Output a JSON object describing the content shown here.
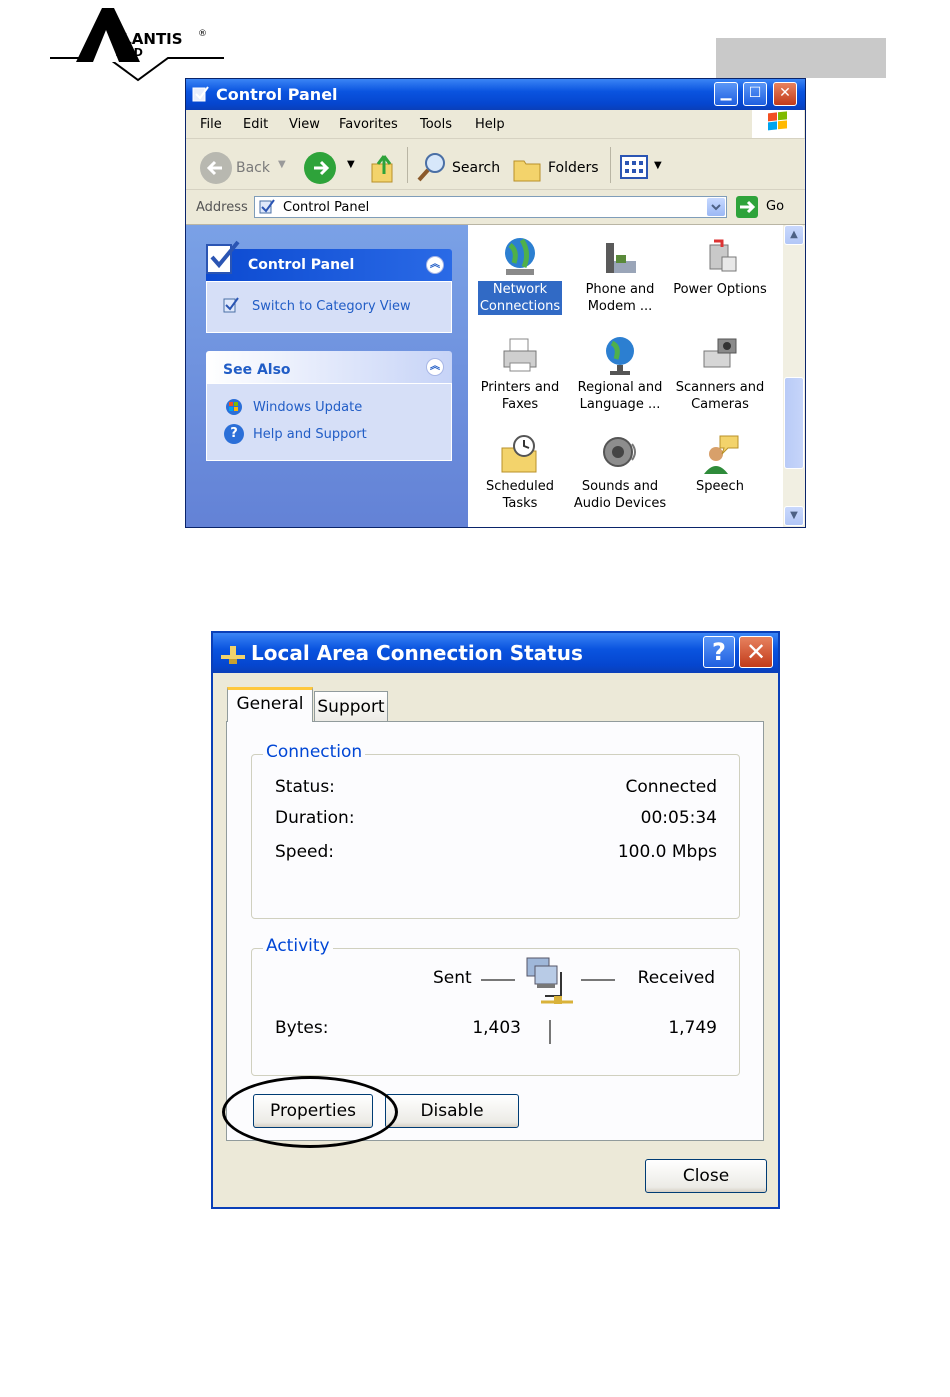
{
  "header": {
    "logo_text": "ATLANTIS LAND"
  },
  "control_panel": {
    "title": "Control Panel",
    "menu": [
      "File",
      "Edit",
      "View",
      "Favorites",
      "Tools",
      "Help"
    ],
    "toolbar": {
      "back": "Back",
      "search": "Search",
      "folders": "Folders"
    },
    "address": {
      "label": "Address",
      "value": "Control Panel",
      "go": "Go"
    },
    "tasks": {
      "title": "Control Panel",
      "link": "Switch to Category View"
    },
    "see_also": {
      "title": "See Also",
      "links": [
        "Windows Update",
        "Help and Support"
      ]
    },
    "icons": [
      {
        "line1": "Network",
        "line2": "Connections",
        "selected": true
      },
      {
        "line1": "Phone and",
        "line2": "Modem ..."
      },
      {
        "line1": "Power Options",
        "line2": ""
      },
      {
        "line1": "Printers and",
        "line2": "Faxes"
      },
      {
        "line1": "Regional and",
        "line2": "Language ..."
      },
      {
        "line1": "Scanners and",
        "line2": "Cameras"
      },
      {
        "line1": "Scheduled",
        "line2": "Tasks"
      },
      {
        "line1": "Sounds and",
        "line2": "Audio Devices"
      },
      {
        "line1": "Speech",
        "line2": ""
      }
    ]
  },
  "lac_status": {
    "title": "Local Area Connection Status",
    "tabs": [
      "General",
      "Support"
    ],
    "connection": {
      "label": "Connection",
      "status_label": "Status:",
      "status_value": "Connected",
      "duration_label": "Duration:",
      "duration_value": "00:05:34",
      "speed_label": "Speed:",
      "speed_value": "100.0 Mbps"
    },
    "activity": {
      "label": "Activity",
      "sent_label": "Sent",
      "received_label": "Received",
      "bytes_label": "Bytes:",
      "bytes_sent": "1,403",
      "bytes_received": "1,749"
    },
    "buttons": {
      "properties": "Properties",
      "disable": "Disable",
      "close": "Close"
    }
  }
}
